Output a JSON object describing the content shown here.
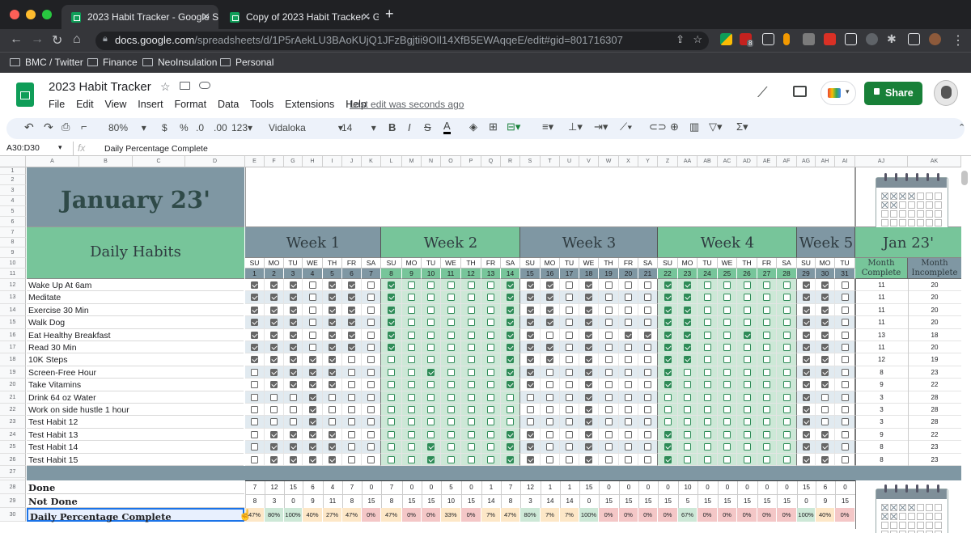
{
  "browser": {
    "tabs": [
      {
        "title": "2023 Habit Tracker - Google Sh",
        "active": true
      },
      {
        "title": "Copy of 2023 Habit Tracker - G",
        "active": false
      }
    ],
    "url_host": "docs.google.com",
    "url_path": "/spreadsheets/d/1P5rAekLU3BAoKUjQ1JFzBgjtii9OIl14XfB5EWAqqeE/edit#gid=801716307",
    "extension_badge": "8",
    "bookmarks": [
      "BMC / Twitter",
      "Finance",
      "NeoInsulation",
      "Personal"
    ]
  },
  "sheet": {
    "title": "2023 Habit Tracker",
    "menu": [
      "File",
      "Edit",
      "View",
      "Insert",
      "Format",
      "Data",
      "Tools",
      "Extensions",
      "Help"
    ],
    "last_edit": "Last edit was seconds ago",
    "share_label": "Share",
    "zoom": "80%",
    "currency": "$",
    "percent": "%",
    "dec_less": ".0",
    "dec_more": ".00",
    "number_format": "123",
    "font": "Vidaloka",
    "font_size": "14",
    "name_box": "A30:D30",
    "fx": "fx",
    "formula": "Daily Percentage Complete"
  },
  "columns": [
    "A",
    "B",
    "C",
    "D",
    "E",
    "F",
    "G",
    "H",
    "I",
    "J",
    "K",
    "L",
    "M",
    "N",
    "O",
    "P",
    "Q",
    "R",
    "S",
    "T",
    "U",
    "V",
    "W",
    "X",
    "Y",
    "Z",
    "AA",
    "AB",
    "AC",
    "AD",
    "AE",
    "AF",
    "AG",
    "AH",
    "AI",
    "AJ",
    "AK"
  ],
  "rows": [
    "1",
    "2",
    "3",
    "4",
    "5",
    "6",
    "7",
    "8",
    "9",
    "10",
    "11",
    "12",
    "13",
    "14",
    "15",
    "16",
    "17",
    "18",
    "19",
    "20",
    "21",
    "22",
    "23",
    "24",
    "25",
    "26",
    "27",
    "28",
    "29",
    "30"
  ],
  "tracker": {
    "month_title": "January 23'",
    "daily_habits": "Daily Habits",
    "weeks": [
      "Week 1",
      "Week 2",
      "Week 3",
      "Week 4",
      "Week 5"
    ],
    "jan_label": "Jan 23'",
    "month_complete": "Month Complete",
    "month_incomplete": "Month Incomplete",
    "days": [
      "SU",
      "MO",
      "TU",
      "WE",
      "TH",
      "FR",
      "SA",
      "SU",
      "MO",
      "TU",
      "WE",
      "TH",
      "FR",
      "SA",
      "SU",
      "MO",
      "TU",
      "WE",
      "TH",
      "FR",
      "SA",
      "SU",
      "MO",
      "TU",
      "WE",
      "TH",
      "FR",
      "SA",
      "SU",
      "MO",
      "TU"
    ],
    "dates": [
      "1",
      "2",
      "3",
      "4",
      "5",
      "6",
      "7",
      "8",
      "9",
      "10",
      "11",
      "12",
      "13",
      "14",
      "15",
      "16",
      "17",
      "18",
      "19",
      "20",
      "21",
      "22",
      "23",
      "24",
      "25",
      "26",
      "27",
      "28",
      "29",
      "30",
      "31"
    ],
    "habits": [
      {
        "name": "Wake Up At 6am",
        "complete": "11",
        "incomplete": "20",
        "checks": "1110110100000111010001100000110"
      },
      {
        "name": "Meditate",
        "complete": "11",
        "incomplete": "20",
        "checks": "1110110100000111010001100000110"
      },
      {
        "name": "Exercise 30 Min",
        "complete": "11",
        "incomplete": "20",
        "checks": "1110110100000111010001100000110"
      },
      {
        "name": "Walk Dog",
        "complete": "11",
        "incomplete": "20",
        "checks": "1110110100000111010001100000110"
      },
      {
        "name": "Eat Healthy Breakfast",
        "complete": "13",
        "incomplete": "18",
        "checks": "1110110100000110010111100100110"
      },
      {
        "name": "Read 30 Min",
        "complete": "11",
        "incomplete": "20",
        "checks": "1110110100000111010001100000110"
      },
      {
        "name": "10K Steps",
        "complete": "12",
        "incomplete": "19",
        "checks": "1111100000000111010001100000110"
      },
      {
        "name": "Screen-Free Hour",
        "complete": "8",
        "incomplete": "23",
        "checks": "0111100001000110010001000000110"
      },
      {
        "name": "Take Vitamins",
        "complete": "9",
        "incomplete": "22",
        "checks": "0111100000000110010001000000110"
      },
      {
        "name": "Drink 64 oz Water",
        "complete": "3",
        "incomplete": "28",
        "checks": "0001000000000000010000000000100"
      },
      {
        "name": "Work on side hustle 1 hour",
        "complete": "3",
        "incomplete": "28",
        "checks": "0001000000000000010000000000100"
      },
      {
        "name": "Test Habit 12",
        "complete": "3",
        "incomplete": "28",
        "checks": "0001000000000000010000000000100"
      },
      {
        "name": "Test Habit 13",
        "complete": "9",
        "incomplete": "22",
        "checks": "0111100000000110010001000000110"
      },
      {
        "name": "Test Habit 14",
        "complete": "8",
        "incomplete": "23",
        "checks": "0111100001000110010001000000110"
      },
      {
        "name": "Test Habit 15",
        "complete": "8",
        "incomplete": "23",
        "checks": "0111100001000110010001000000110"
      }
    ],
    "done_label": "Done",
    "not_done_label": "Not Done",
    "pct_label": "Daily Percentage Complete",
    "done": [
      "7",
      "12",
      "15",
      "6",
      "4",
      "7",
      "0",
      "7",
      "0",
      "0",
      "5",
      "0",
      "1",
      "7",
      "12",
      "1",
      "1",
      "15",
      "0",
      "0",
      "0",
      "0",
      "10",
      "0",
      "0",
      "0",
      "0",
      "0",
      "15",
      "6",
      "0"
    ],
    "not_done": [
      "8",
      "3",
      "0",
      "9",
      "11",
      "8",
      "15",
      "8",
      "15",
      "15",
      "10",
      "15",
      "14",
      "8",
      "3",
      "14",
      "14",
      "0",
      "15",
      "15",
      "15",
      "15",
      "5",
      "15",
      "15",
      "15",
      "15",
      "15",
      "0",
      "9",
      "15"
    ],
    "pct": [
      "47%",
      "80%",
      "100%",
      "40%",
      "27%",
      "47%",
      "0%",
      "47%",
      "0%",
      "0%",
      "33%",
      "0%",
      "7%",
      "47%",
      "80%",
      "7%",
      "7%",
      "100%",
      "0%",
      "0%",
      "0%",
      "0%",
      "67%",
      "0%",
      "0%",
      "0%",
      "0%",
      "0%",
      "100%",
      "40%",
      "0%"
    ]
  },
  "colors": {
    "slate": "#7f97a3",
    "green": "#77c59a",
    "light_green": "#cde8d7",
    "light_blue": "#e1eaf0",
    "pink": "#f4c7c7",
    "share": "#188038"
  }
}
